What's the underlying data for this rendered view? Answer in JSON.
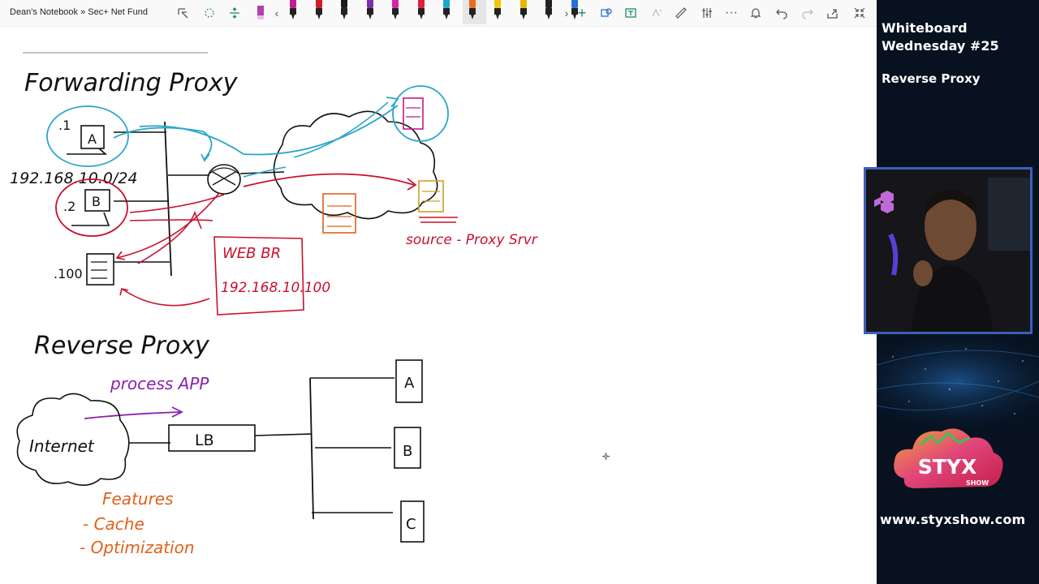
{
  "toolbar": {
    "breadcrumb": "Dean's Notebook » Sec+ Net Fund",
    "pens": [
      {
        "name": "pen-magenta",
        "color": "#c21d8e"
      },
      {
        "name": "pen-red",
        "color": "#d11c2c"
      },
      {
        "name": "pen-black",
        "color": "#1a1a1a"
      },
      {
        "name": "pen-purple",
        "color": "#7b2fb0"
      },
      {
        "name": "pen-pink",
        "color": "#d6249f"
      },
      {
        "name": "pen-crimson",
        "color": "#e0203a"
      },
      {
        "name": "pen-cyan",
        "color": "#1aa7c9"
      },
      {
        "name": "pen-orange-selected",
        "color": "#ee6a1b"
      },
      {
        "name": "pen-yellow",
        "color": "#f1c40f"
      },
      {
        "name": "pen-gold",
        "color": "#e6b800"
      },
      {
        "name": "pen-dark",
        "color": "#222222"
      },
      {
        "name": "pen-blue",
        "color": "#2a6fdb"
      }
    ]
  },
  "whiteboard": {
    "forward_title": "Forwarding Proxy",
    "host_a_ip": ".1",
    "host_a_label": "A",
    "subnet": "192.168.10.0/24",
    "host_b_ip": ".2",
    "host_b_label": "B",
    "server_ip": ".100",
    "web_br": "WEB BR",
    "web_br_ip": "192.168.10.100",
    "source_note": "source - Proxy Srvr",
    "reverse_title": "Reverse Proxy",
    "process_app": "process APP",
    "internet": "Internet",
    "lb": "LB",
    "server_a": "A",
    "server_b": "B",
    "server_c": "C",
    "features_title": "Features",
    "feature_1": "- Cache",
    "feature_2": "- Optimization"
  },
  "sidebar": {
    "show_title": "Whiteboard Wednesday #25",
    "show_subtitle": "Reverse Proxy",
    "logo_text": "STYX",
    "logo_subtext": "SHOW",
    "website": "www.styxshow.com"
  },
  "colors": {
    "ink_black": "#111111",
    "ink_cyan": "#2aa6c8",
    "ink_red": "#c8102e",
    "ink_magenta": "#c2188a",
    "ink_orange": "#e0601a",
    "ink_gold": "#c9a227",
    "ink_purple": "#8b1fae",
    "sidebar_bg": "#07111f",
    "webcam_border": "#3d5fb8"
  }
}
